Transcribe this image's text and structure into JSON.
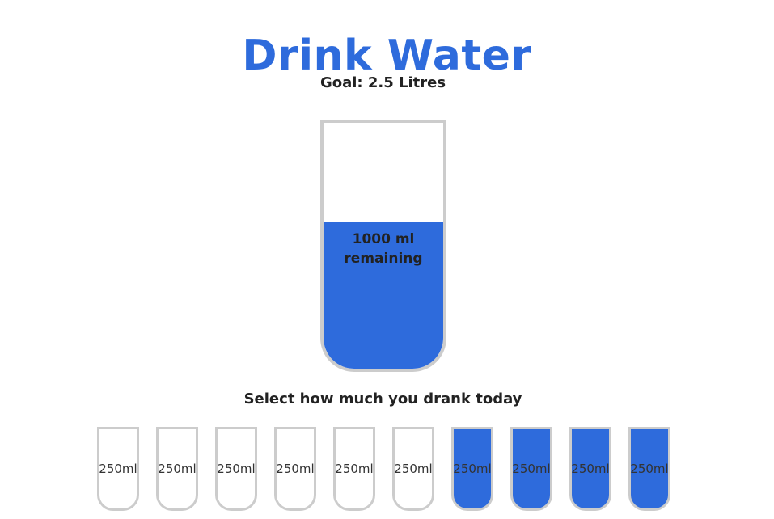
{
  "title": "Drink Water",
  "goal_text": "Goal: 2.5 Litres",
  "big_cup": {
    "remaining_amount": "1000 ml",
    "remaining_label": "remaining",
    "fill_fraction": 0.6
  },
  "select_text": "Select how much you drank today",
  "cups": [
    {
      "label": "250ml",
      "filled": false
    },
    {
      "label": "250ml",
      "filled": false
    },
    {
      "label": "250ml",
      "filled": false
    },
    {
      "label": "250ml",
      "filled": false
    },
    {
      "label": "250ml",
      "filled": false
    },
    {
      "label": "250ml",
      "filled": false
    },
    {
      "label": "250ml",
      "filled": true
    },
    {
      "label": "250ml",
      "filled": true
    },
    {
      "label": "250ml",
      "filled": true
    },
    {
      "label": "250ml",
      "filled": true
    }
  ],
  "colors": {
    "accent": "#2e6bdc",
    "border": "#cccccc"
  }
}
